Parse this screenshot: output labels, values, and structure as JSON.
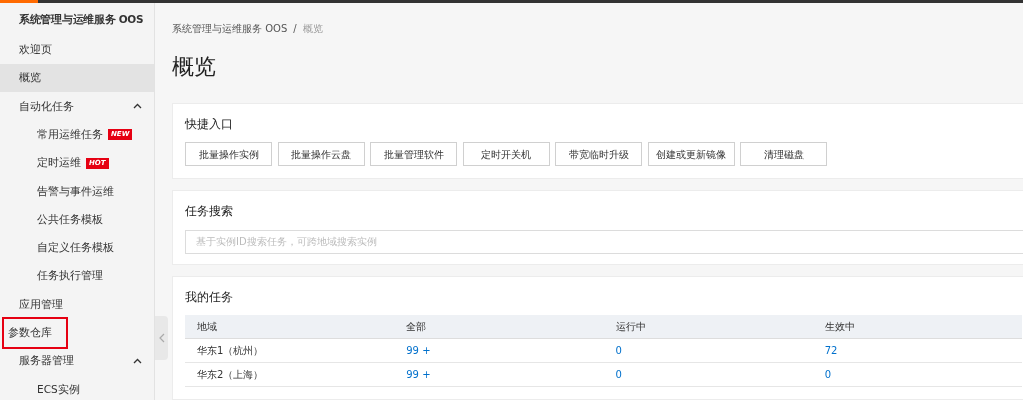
{
  "sidebar": {
    "title": "系统管理与运维服务 OOS",
    "items": [
      {
        "label": "欢迎页",
        "selected": false,
        "highlighted": false
      },
      {
        "label": "概览",
        "selected": true,
        "highlighted": false
      },
      {
        "label": "自动化任务",
        "selected": false,
        "highlighted": false,
        "expanded": true,
        "children": [
          {
            "label": "常用运维任务",
            "badge": "NEW",
            "selected": false,
            "highlighted": false
          },
          {
            "label": "定时运维",
            "badge": "HOT",
            "selected": false,
            "highlighted": false
          },
          {
            "label": "告警与事件运维",
            "selected": false,
            "highlighted": false
          },
          {
            "label": "公共任务模板",
            "selected": false,
            "highlighted": false
          },
          {
            "label": "自定义任务模板",
            "selected": false,
            "highlighted": false
          },
          {
            "label": "任务执行管理",
            "selected": false,
            "highlighted": false
          }
        ]
      },
      {
        "label": "应用管理",
        "selected": false,
        "highlighted": false
      },
      {
        "label": "参数仓库",
        "selected": false,
        "highlighted": true
      },
      {
        "label": "服务器管理",
        "selected": false,
        "highlighted": false,
        "expanded": true,
        "children": [
          {
            "label": "ECS实例",
            "selected": false,
            "highlighted": false
          }
        ]
      }
    ]
  },
  "breadcrumb": {
    "separator": "/",
    "items": [
      "系统管理与运维服务 OOS",
      "概览"
    ]
  },
  "page_title": "概览",
  "quick_entry": {
    "title": "快捷入口",
    "buttons": [
      "批量操作实例",
      "批量操作云盘",
      "批量管理软件",
      "定时开关机",
      "带宽临时升级",
      "创建或更新镜像",
      "清理磁盘"
    ]
  },
  "task_search": {
    "title": "任务搜索",
    "placeholder": "基于实例ID搜索任务，可跨地域搜索实例"
  },
  "my_tasks": {
    "title": "我的任务",
    "table": {
      "columns": [
        "地域",
        "全部",
        "运行中",
        "生效中"
      ],
      "rows": [
        [
          "华东1（杭州）",
          "99 +",
          "0",
          "72"
        ],
        [
          "华东2（上海）",
          "99 +",
          "0",
          "0"
        ]
      ]
    }
  }
}
